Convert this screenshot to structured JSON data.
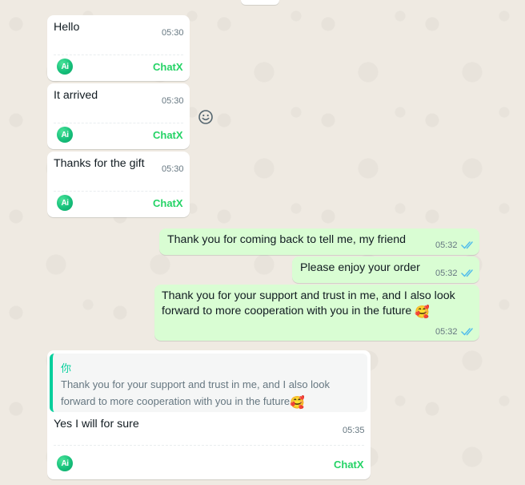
{
  "chat": {
    "incoming": [
      {
        "text": "Hello",
        "time": "05:30",
        "brand": "ChatX",
        "ai_icon": "Ai"
      },
      {
        "text": "It arrived",
        "time": "05:30",
        "brand": "ChatX",
        "ai_icon": "Ai"
      },
      {
        "text": "Thanks for the gift",
        "time": "05:30",
        "brand": "ChatX",
        "ai_icon": "Ai"
      }
    ],
    "outgoing": [
      {
        "text": "Thank you for coming back to tell me, my friend",
        "time": "05:32",
        "status": "read"
      },
      {
        "text": "Please enjoy your order",
        "time": "05:32",
        "status": "read"
      },
      {
        "text": "Thank you for your support and trust in me, and I also look forward to more cooperation with you in the future",
        "emoji": "🥰",
        "time": "05:32",
        "status": "read"
      }
    ],
    "reply": {
      "quote_author": "你",
      "quote_text": "Thank you for your support and trust in me, and I also look forward to more cooperation with you in the future",
      "quote_emoji": "🥰",
      "text": "Yes I will for sure",
      "time": "05:35",
      "brand": "ChatX",
      "ai_icon": "Ai"
    }
  },
  "icons": {
    "emoji": "smiley-face-icon",
    "read_receipt": "double-check-icon",
    "assistant": "ai-icon"
  },
  "colors": {
    "background": "#efeae2",
    "incoming_bubble": "#ffffff",
    "outgoing_bubble": "#d9fdd3",
    "brand": "#25d366",
    "read_tick": "#53bdeb",
    "quote_accent": "#06cf9c"
  }
}
